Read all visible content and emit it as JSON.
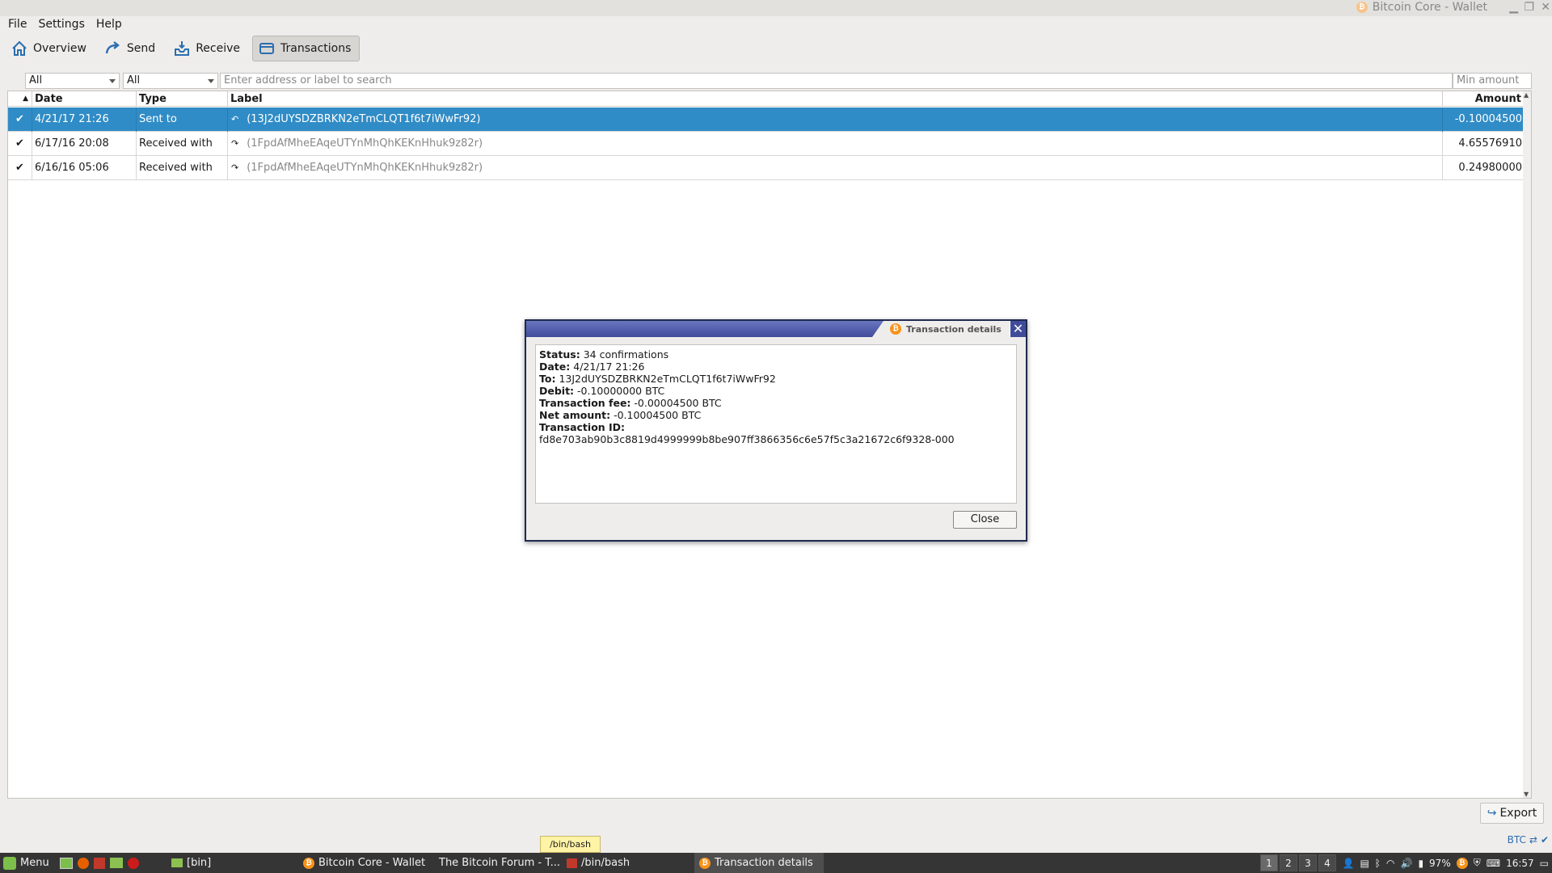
{
  "window": {
    "title": "Bitcoin Core - Wallet"
  },
  "menubar": {
    "items": [
      "File",
      "Settings",
      "Help"
    ]
  },
  "toolbar": {
    "overview": "Overview",
    "send": "Send",
    "receive": "Receive",
    "transactions": "Transactions"
  },
  "filters": {
    "date": "All",
    "type": "All",
    "search_placeholder": "Enter address or label to search",
    "min_amount_placeholder": "Min amount"
  },
  "table": {
    "headers": {
      "date": "Date",
      "type": "Type",
      "label": "Label",
      "amount": "Amount (BTC)"
    },
    "rows": [
      {
        "date": "4/21/17 21:26",
        "type": "Sent to",
        "label": "(13J2dUYSDZBRKN2eTmCLQT1f6t7iWwFr92)",
        "amount": "-0.10004500",
        "selected": true
      },
      {
        "date": "6/17/16 20:08",
        "type": "Received with",
        "label": "(1FpdAfMheEAqeUTYnMhQhKEKnHhuk9z82r)",
        "amount": "4.65576910",
        "selected": false
      },
      {
        "date": "6/16/16 05:06",
        "type": "Received with",
        "label": "(1FpdAfMheEAqeUTYnMhQhKEKnHhuk9z82r)",
        "amount": "0.24980000",
        "selected": false
      }
    ]
  },
  "dialog": {
    "title": "Transaction details",
    "status_label": "Status:",
    "status": "34 confirmations",
    "date_label": "Date:",
    "date": "4/21/17 21:26",
    "to_label": "To:",
    "to": "13J2dUYSDZBRKN2eTmCLQT1f6t7iWwFr92",
    "debit_label": "Debit:",
    "debit": "-0.10000000 BTC",
    "fee_label": "Transaction fee:",
    "fee": "-0.00004500 BTC",
    "net_label": "Net amount:",
    "net": "-0.10004500 BTC",
    "txid_label": "Transaction ID:",
    "txid": "fd8e703ab90b3c8819d4999999b8be907ff3866356c6e57f5c3a21672c6f9328-000",
    "close_button": "Close"
  },
  "export_button": "Export",
  "tooltip": "/bin/bash",
  "status_unit": "BTC",
  "taskbar": {
    "menu": "Menu",
    "items": [
      {
        "label": "[bin]"
      },
      {
        "label": "Bitcoin Core - Wallet"
      },
      {
        "label": "The Bitcoin Forum - T..."
      },
      {
        "label": "/bin/bash"
      },
      {
        "label": "Transaction details"
      }
    ],
    "workspaces": [
      "1",
      "2",
      "3",
      "4"
    ],
    "battery": "97%",
    "clock": "16:57"
  },
  "colors": {
    "selection": "#308cc6",
    "dialog_title": "#404c9a",
    "bitcoin": "#f7931a",
    "taskbar": "#353535"
  }
}
